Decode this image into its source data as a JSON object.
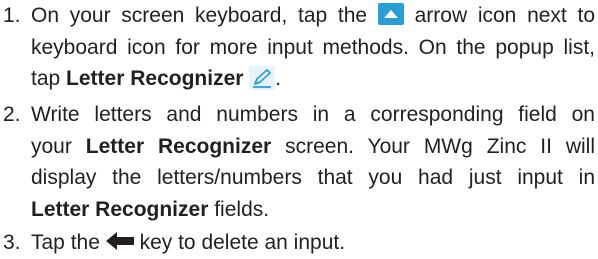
{
  "steps": [
    {
      "number": "1.",
      "line1": {
        "a": "On your screen keyboard, tap the",
        "b": "arrow icon next to"
      },
      "line2": "keyboard icon for more input methods. On the popup list,",
      "line3": {
        "a": "tap",
        "bold": "Letter Recognizer",
        "end": "."
      }
    },
    {
      "number": "2.",
      "line1": "Write letters and numbers in a corresponding field on",
      "line2": {
        "a": "your",
        "bold": "Letter Recognizer",
        "b": "screen. Your MWg Zinc II will"
      },
      "line3": "display the letters/numbers that you had just input in",
      "line4": {
        "bold": "Letter Recognizer",
        "b": "fields."
      }
    },
    {
      "number": "3.",
      "line1": {
        "a": "Tap the",
        "b": "key to delete an input."
      }
    }
  ],
  "icons": {
    "arrow_up": "arrow-up-icon",
    "letter_recognizer": "pen-icon",
    "backspace": "backspace-arrow-icon",
    "accent_color": "#2a9fd6"
  }
}
